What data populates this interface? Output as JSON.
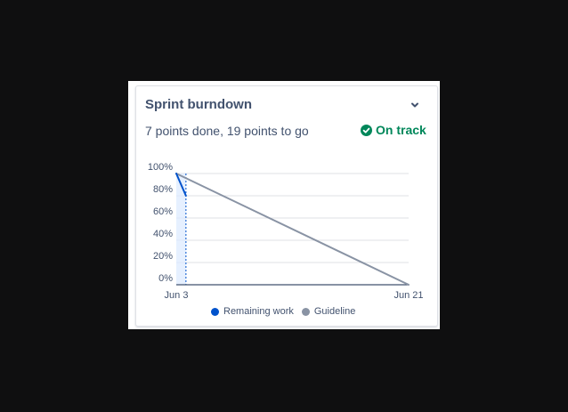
{
  "card": {
    "title": "Sprint burndown",
    "summary": "7 points done, 19 points to go",
    "status_label": "On track",
    "status_color": "#00875a",
    "expand_icon": "chevron-down-icon",
    "status_icon": "check-circle-icon"
  },
  "chart_data": {
    "type": "line",
    "x_labels": [
      "Jun 3",
      "Jun 21"
    ],
    "y_ticks": [
      "0%",
      "20%",
      "40%",
      "60%",
      "80%",
      "100%"
    ],
    "ylim": [
      0,
      100
    ],
    "grid": true,
    "series": [
      {
        "name": "Remaining work",
        "color": "#0052cc",
        "x": [
          0,
          0.75
        ],
        "y": [
          100,
          80
        ]
      },
      {
        "name": "Guideline",
        "color": "#8993a4",
        "x": [
          0,
          18
        ],
        "y": [
          100,
          0
        ]
      }
    ],
    "today_marker": 0.75,
    "x_span": 18
  }
}
